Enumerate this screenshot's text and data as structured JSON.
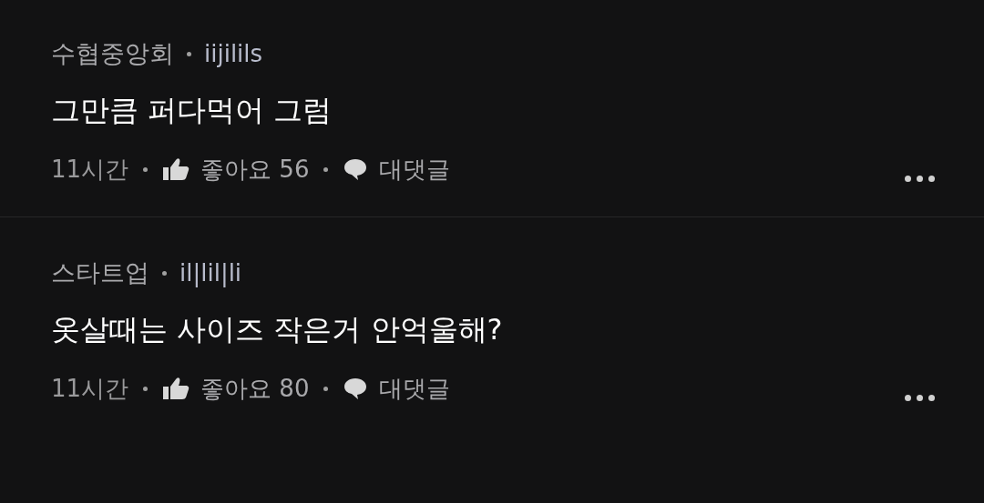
{
  "comments": [
    {
      "author": "수협중앙회",
      "username": "iijilils",
      "text": "그만큼 퍼다먹어 그럼",
      "time": "11시간",
      "like_label": "좋아요 56",
      "reply_label": "대댓글"
    },
    {
      "author": "스타트업",
      "username": "il|lil|li",
      "text": "옷살때는 사이즈 작은거 안억울해?",
      "time": "11시간",
      "like_label": "좋아요 80",
      "reply_label": "대댓글"
    }
  ]
}
